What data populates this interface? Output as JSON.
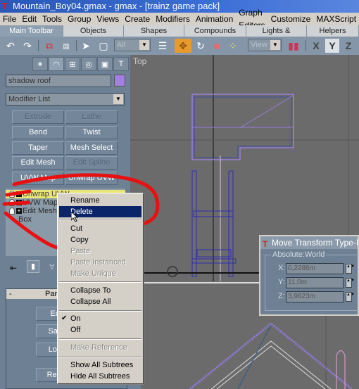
{
  "window": {
    "title": "Mountain_Boy04.gmax - gmax - [trainz game pack]"
  },
  "menu": [
    "File",
    "Edit",
    "Tools",
    "Group",
    "Views",
    "Create",
    "Modifiers",
    "Animation",
    "Graph Editors",
    "Customize",
    "MAXScript"
  ],
  "tabs": [
    {
      "label": "Main Toolbar",
      "active": true
    },
    {
      "label": "Objects"
    },
    {
      "label": "Shapes"
    },
    {
      "label": "Compounds"
    },
    {
      "label": "Lights & Cameras"
    },
    {
      "label": "Helpers"
    }
  ],
  "toolbar": {
    "selection_filter": "All",
    "coord_system": "View",
    "axis_x": "X",
    "axis_y": "Y",
    "axis_z": "Z",
    "icons": [
      "undo-icon",
      "redo-icon",
      "select-link-icon",
      "unlink-icon",
      "select-icon",
      "region-select-icon",
      "select-by-name-icon",
      "move-icon",
      "rotate-icon",
      "scale-icon",
      "pivot-icon",
      "mirror-icon"
    ]
  },
  "command_panel": {
    "object_name": "shadow roof",
    "object_color": "#a27ee6",
    "modifier_list": "Modifier List",
    "modifier_buttons": [
      {
        "label": "Extrude",
        "disabled": true
      },
      {
        "label": "Lathe",
        "disabled": true
      },
      {
        "label": "Bend"
      },
      {
        "label": "Twist"
      },
      {
        "label": "Taper"
      },
      {
        "label": "Mesh Select"
      },
      {
        "label": "Edit Mesh"
      },
      {
        "label": "Edit Spline",
        "disabled": true
      },
      {
        "label": "UVW Map"
      },
      {
        "label": "Unwrap UVW"
      }
    ],
    "stack": [
      {
        "label": "Unwrap UVW",
        "selected": true
      },
      {
        "label": "UVW Mapping"
      },
      {
        "label": "Edit Mesh"
      },
      {
        "label": "Box"
      }
    ]
  },
  "context_menu": {
    "items": [
      {
        "label": "Rename"
      },
      {
        "label": "Delete",
        "highlighted": true
      },
      {
        "sep": true
      },
      {
        "label": "Cut"
      },
      {
        "label": "Copy"
      },
      {
        "label": "Paste",
        "disabled": true
      },
      {
        "label": "Paste Instanced",
        "disabled": true
      },
      {
        "label": "Make Unique",
        "disabled": true
      },
      {
        "sep": true
      },
      {
        "label": "Collapse To"
      },
      {
        "label": "Collapse All"
      },
      {
        "sep": true
      },
      {
        "label": "On",
        "checked": true
      },
      {
        "label": "Off"
      },
      {
        "sep": true
      },
      {
        "label": "Make Reference",
        "disabled": true
      },
      {
        "sep": true
      },
      {
        "label": "Show All Subtrees"
      },
      {
        "label": "Hide All Subtrees"
      }
    ]
  },
  "parameters": {
    "header": "Parameters",
    "collapse": "-",
    "buttons": [
      "Edit",
      "Save",
      "Load",
      "Reset"
    ]
  },
  "viewports": {
    "top_label": "Top"
  },
  "move_dialog": {
    "title": "Move Transform Type-In",
    "group": "Absolute:World",
    "x_label": "X:",
    "x_value": "0,2286m",
    "y_label": "Y:",
    "y_value": "11,0m",
    "z_label": "Z:",
    "z_value": "3,9623m"
  },
  "annotation_color": "#e81010"
}
